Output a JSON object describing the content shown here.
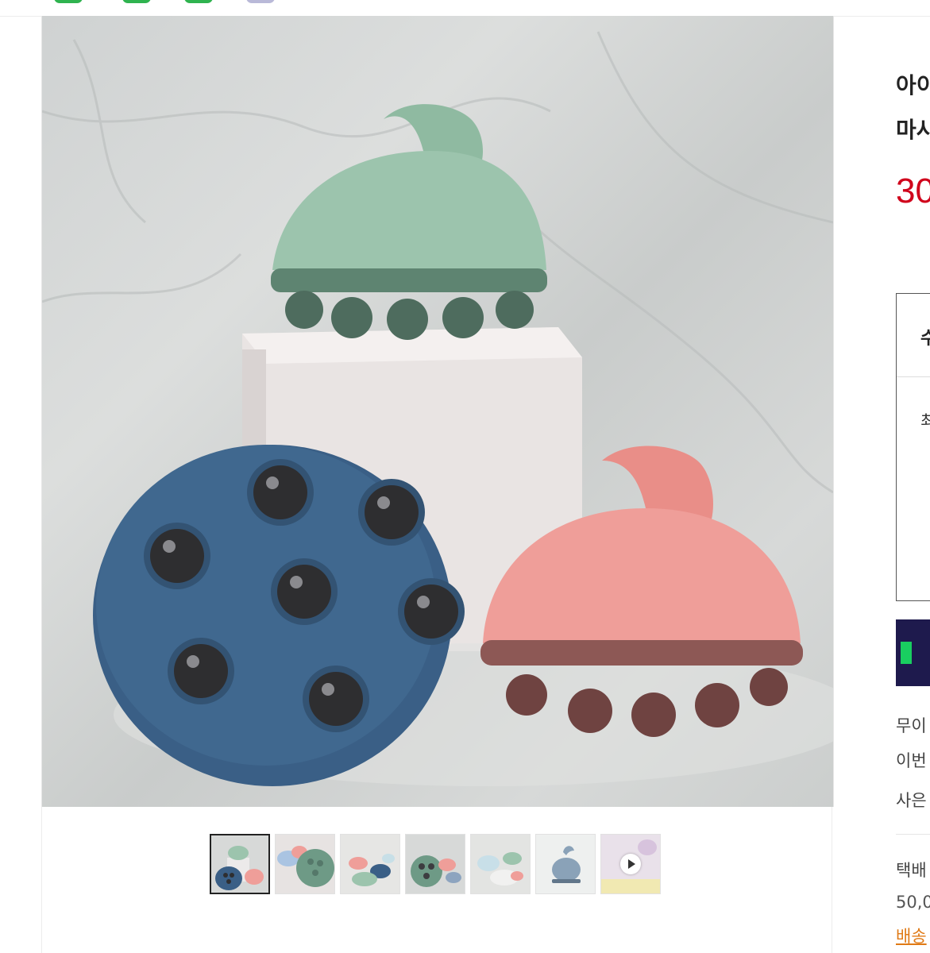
{
  "product": {
    "title_line1": "아이",
    "title_line2": "마사",
    "price": "30"
  },
  "options": {
    "header": "수",
    "row": "최"
  },
  "info": {
    "line1": "무이",
    "line2": "이번",
    "line3": "사은"
  },
  "shipping": {
    "label": "택배",
    "price": "50,0",
    "link": "배송"
  },
  "gallery": {
    "thumbnail_count": 7,
    "selected_index": 0,
    "last_is_video": true
  },
  "colors": {
    "price": "#d0021b",
    "buy_button": "#1e1a4d",
    "buy_badge": "#19ce60",
    "link": "#e07a16",
    "massager_green": "#9cc4ad",
    "massager_blue": "#3a5f86",
    "massager_pink": "#ef9e99"
  }
}
